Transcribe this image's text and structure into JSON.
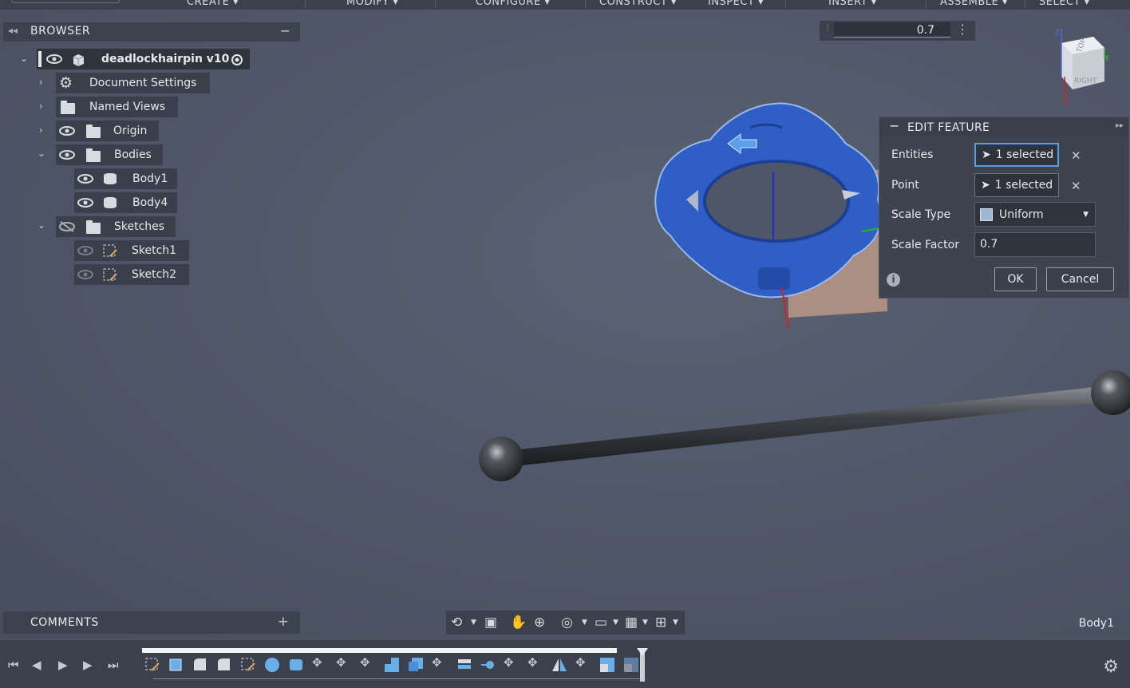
{
  "toolbar": {
    "menus": [
      "CREATE ▾",
      "MODIFY ▾",
      "CONFIGURE ▾",
      "CONSTRUCT ▾",
      "INSPECT ▾",
      "INSERT ▾",
      "ASSEMBLE ▾",
      "SELECT ▾"
    ]
  },
  "browser": {
    "title": "BROWSER",
    "document": "deadlockhairpin v10",
    "items": [
      {
        "label": "Document Settings"
      },
      {
        "label": "Named Views"
      },
      {
        "label": "Origin"
      },
      {
        "label": "Bodies"
      },
      {
        "label": "Body1"
      },
      {
        "label": "Body4"
      },
      {
        "label": "Sketches"
      },
      {
        "label": "Sketch1"
      },
      {
        "label": "Sketch2"
      }
    ]
  },
  "value_input": {
    "value": "0.7"
  },
  "viewcube": {
    "top": "TOP",
    "right": "RIGHT"
  },
  "edit_feature": {
    "title": "EDIT FEATURE",
    "entities_label": "Entities",
    "entities_value": "1 selected",
    "point_label": "Point",
    "point_value": "1 selected",
    "scale_type_label": "Scale Type",
    "scale_type_value": "Uniform",
    "scale_factor_label": "Scale Factor",
    "scale_factor_value": "0.7",
    "ok": "OK",
    "cancel": "Cancel"
  },
  "comments": {
    "title": "COMMENTS"
  },
  "status": {
    "selection": "Body1"
  },
  "colors": {
    "accent": "#5b9be0",
    "selected_body": "#2f5fc4",
    "background": "#4f5667"
  }
}
